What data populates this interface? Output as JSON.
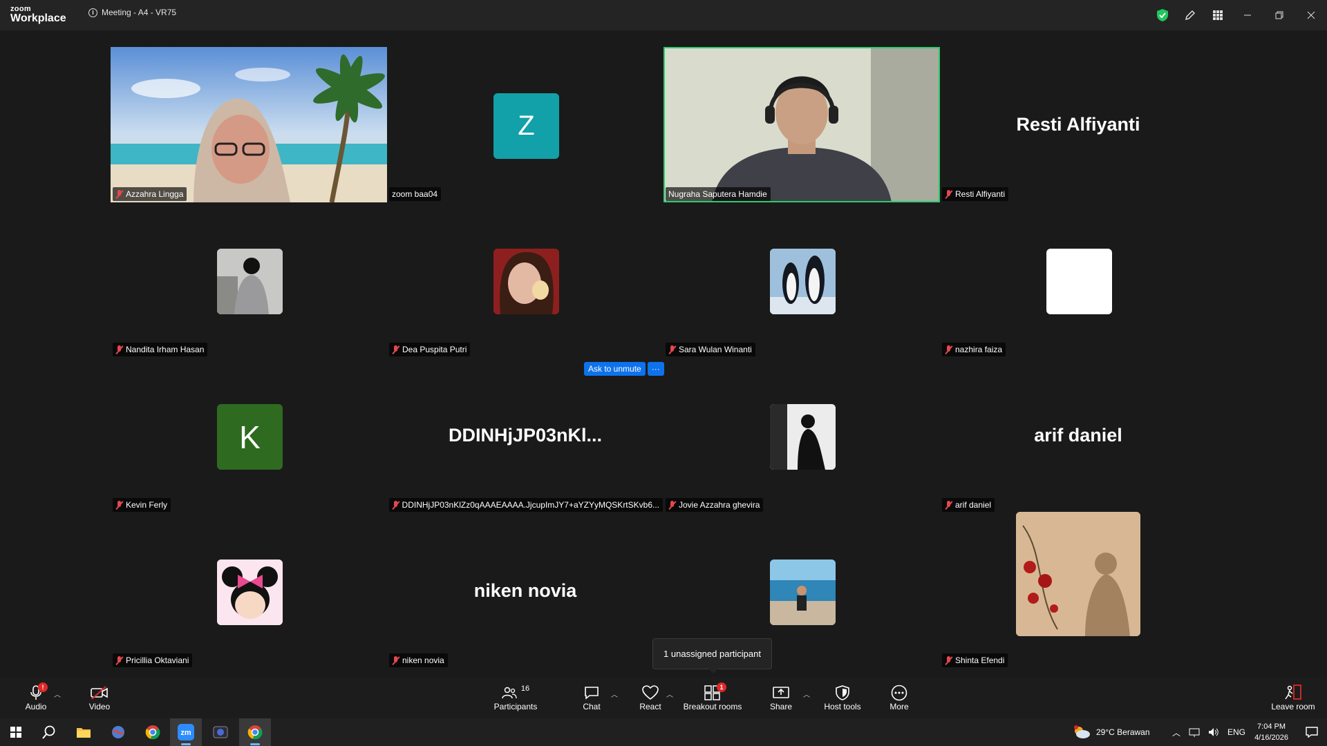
{
  "titlebar": {
    "logo_top": "zoom",
    "logo_bottom": "Workplace",
    "meeting_title": "Meeting - A4 - VR75"
  },
  "colors": {
    "active_speaker_border": "#2ecc71",
    "muted_icon": "#e5484d",
    "accent": "#0e72ed"
  },
  "participants": [
    {
      "name": "Azzahra Lingga",
      "muted": true,
      "display": "video"
    },
    {
      "name": "zoom baa04",
      "muted": false,
      "display": "avatar-letter",
      "letter": "Z",
      "avatar_color": "#12a1a8"
    },
    {
      "name": "Nugraha Saputera Hamdie",
      "muted": false,
      "display": "video",
      "active_speaker": true
    },
    {
      "name": "Resti Alfiyanti",
      "muted": true,
      "display": "big-name",
      "big_name": "Resti Alfiyanti"
    },
    {
      "name": "Nandita Irham Hasan",
      "muted": true,
      "display": "avatar-photo"
    },
    {
      "name": "Dea Puspita Putri",
      "muted": true,
      "display": "avatar-photo"
    },
    {
      "name": "Sara Wulan Winanti",
      "muted": true,
      "display": "avatar-photo"
    },
    {
      "name": "nazhira faiza",
      "muted": true,
      "display": "avatar-photo"
    },
    {
      "name": "Kevin Ferly",
      "muted": true,
      "display": "avatar-letter",
      "letter": "K",
      "avatar_color": "#2e6b20"
    },
    {
      "name": "DDINHjJP03nKlZz0qAAAEAAAA.JjcupImJY7+aYZYyMQSKrtSKvb6...",
      "muted": true,
      "display": "big-name",
      "big_name": "DDINHjJP03nKl..."
    },
    {
      "name": "Jovie Azzahra ghevira",
      "muted": true,
      "display": "avatar-photo"
    },
    {
      "name": "arif daniel",
      "muted": true,
      "display": "big-name",
      "big_name": "arif daniel"
    },
    {
      "name": "Pricillia Oktaviani",
      "muted": true,
      "display": "avatar-photo"
    },
    {
      "name": "niken novia",
      "muted": true,
      "display": "big-name",
      "big_name": "niken novia"
    },
    {
      "name": "",
      "muted": false,
      "display": "avatar-photo"
    },
    {
      "name": "Shinta Efendi",
      "muted": true,
      "display": "avatar-photo-large"
    }
  ],
  "ask_to_unmute": {
    "label": "Ask to unmute",
    "more": "···"
  },
  "tooltip": {
    "text": "1 unassigned participant"
  },
  "toolbar": {
    "audio": "Audio",
    "video": "Video",
    "participants": "Participants",
    "participants_count": "16",
    "chat": "Chat",
    "react": "React",
    "breakout_rooms": "Breakout rooms",
    "breakout_badge": "1",
    "audio_badge": "!",
    "share": "Share",
    "host_tools": "Host tools",
    "more": "More",
    "leave_room": "Leave room"
  },
  "taskbar": {
    "weather": "29°C  Berawan",
    "lang": "ENG",
    "time": "7:04 PM",
    "date": "4/16/2026"
  }
}
